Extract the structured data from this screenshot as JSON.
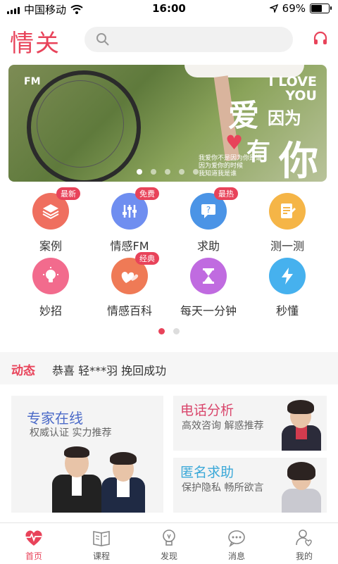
{
  "status": {
    "carrier": "中国移动",
    "time": "16:00",
    "battery": "69%",
    "battery_level": 0.69
  },
  "header": {
    "logo": "情关",
    "search_placeholder": ""
  },
  "banner": {
    "fm": "FM",
    "love": "I LOVE YOU",
    "title_big": "爱",
    "title_small": "因为",
    "title_you": "有",
    "title_ni": "你",
    "subtitle_lines": [
      "我爱你不是因为你是谁",
      "因为爱你的时候",
      "我知道我是谁"
    ],
    "page_count": 5,
    "active_page": 1
  },
  "features": [
    {
      "label": "案例",
      "tag": "最新",
      "icon": "layers-icon",
      "color": "#ef6f5f"
    },
    {
      "label": "情感FM",
      "tag": "免费",
      "icon": "equalizer-icon",
      "color": "#6f8ef0"
    },
    {
      "label": "求助",
      "tag": "最热",
      "icon": "question-chat-icon",
      "color": "#4b94e6"
    },
    {
      "label": "测一测",
      "tag": "",
      "icon": "test-paper-icon",
      "color": "#f5b547"
    },
    {
      "label": "妙招",
      "tag": "",
      "icon": "lightbulb-icon",
      "color": "#f26b8d"
    },
    {
      "label": "情感百科",
      "tag": "经典",
      "icon": "hearts-icon",
      "color": "#ef7a56"
    },
    {
      "label": "每天一分钟",
      "tag": "",
      "icon": "hourglass-icon",
      "color": "#c06be0"
    },
    {
      "label": "秒懂",
      "tag": "",
      "icon": "lightning-icon",
      "color": "#46b1ee"
    }
  ],
  "grid_pager": {
    "count": 2,
    "active": 0
  },
  "news": {
    "title": "动态",
    "text": "恭喜 轻***羽 挽回成功"
  },
  "expert": {
    "title": "专家在线",
    "subtitle": "权威认证  实力推荐",
    "title_color": "#4b6ac8"
  },
  "phone_card": {
    "title": "电话分析",
    "subtitle": "高效咨询  解惑推荐",
    "title_color": "#d9456b"
  },
  "anon_card": {
    "title": "匿名求助",
    "subtitle": "保护隐私  畅所欲言",
    "title_color": "#3aa8d8"
  },
  "tabs": [
    {
      "label": "首页",
      "icon": "heartbeat-icon",
      "active": true
    },
    {
      "label": "课程",
      "icon": "book-icon",
      "active": false
    },
    {
      "label": "发现",
      "icon": "lightbulb-icon",
      "active": false
    },
    {
      "label": "消息",
      "icon": "chat-icon",
      "active": false
    },
    {
      "label": "我的",
      "icon": "user-heart-icon",
      "active": false
    }
  ],
  "colors": {
    "accent": "#e8435a"
  }
}
